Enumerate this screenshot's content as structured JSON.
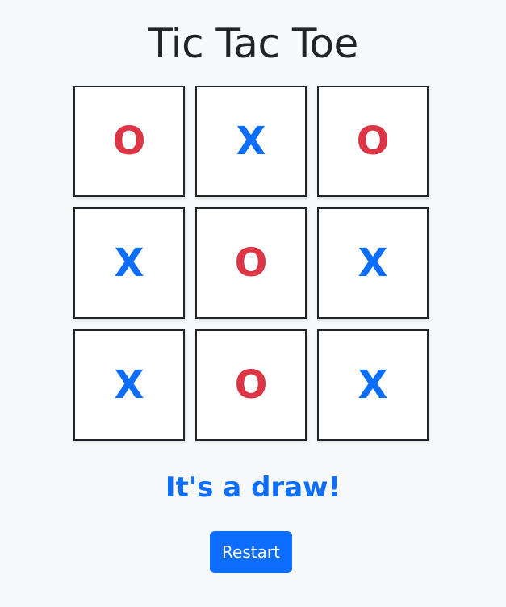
{
  "title": "Tic Tac Toe",
  "board": {
    "cells": [
      {
        "mark": "O"
      },
      {
        "mark": "X"
      },
      {
        "mark": "O"
      },
      {
        "mark": "X"
      },
      {
        "mark": "O"
      },
      {
        "mark": "X"
      },
      {
        "mark": "X"
      },
      {
        "mark": "O"
      },
      {
        "mark": "X"
      }
    ]
  },
  "status": "It's a draw!",
  "restart_label": "Restart",
  "colors": {
    "x_mark": "#0d6efd",
    "o_mark": "#dc3545",
    "status": "#0d6efd",
    "button": "#0d6efd",
    "background": "#f8f9fa"
  }
}
